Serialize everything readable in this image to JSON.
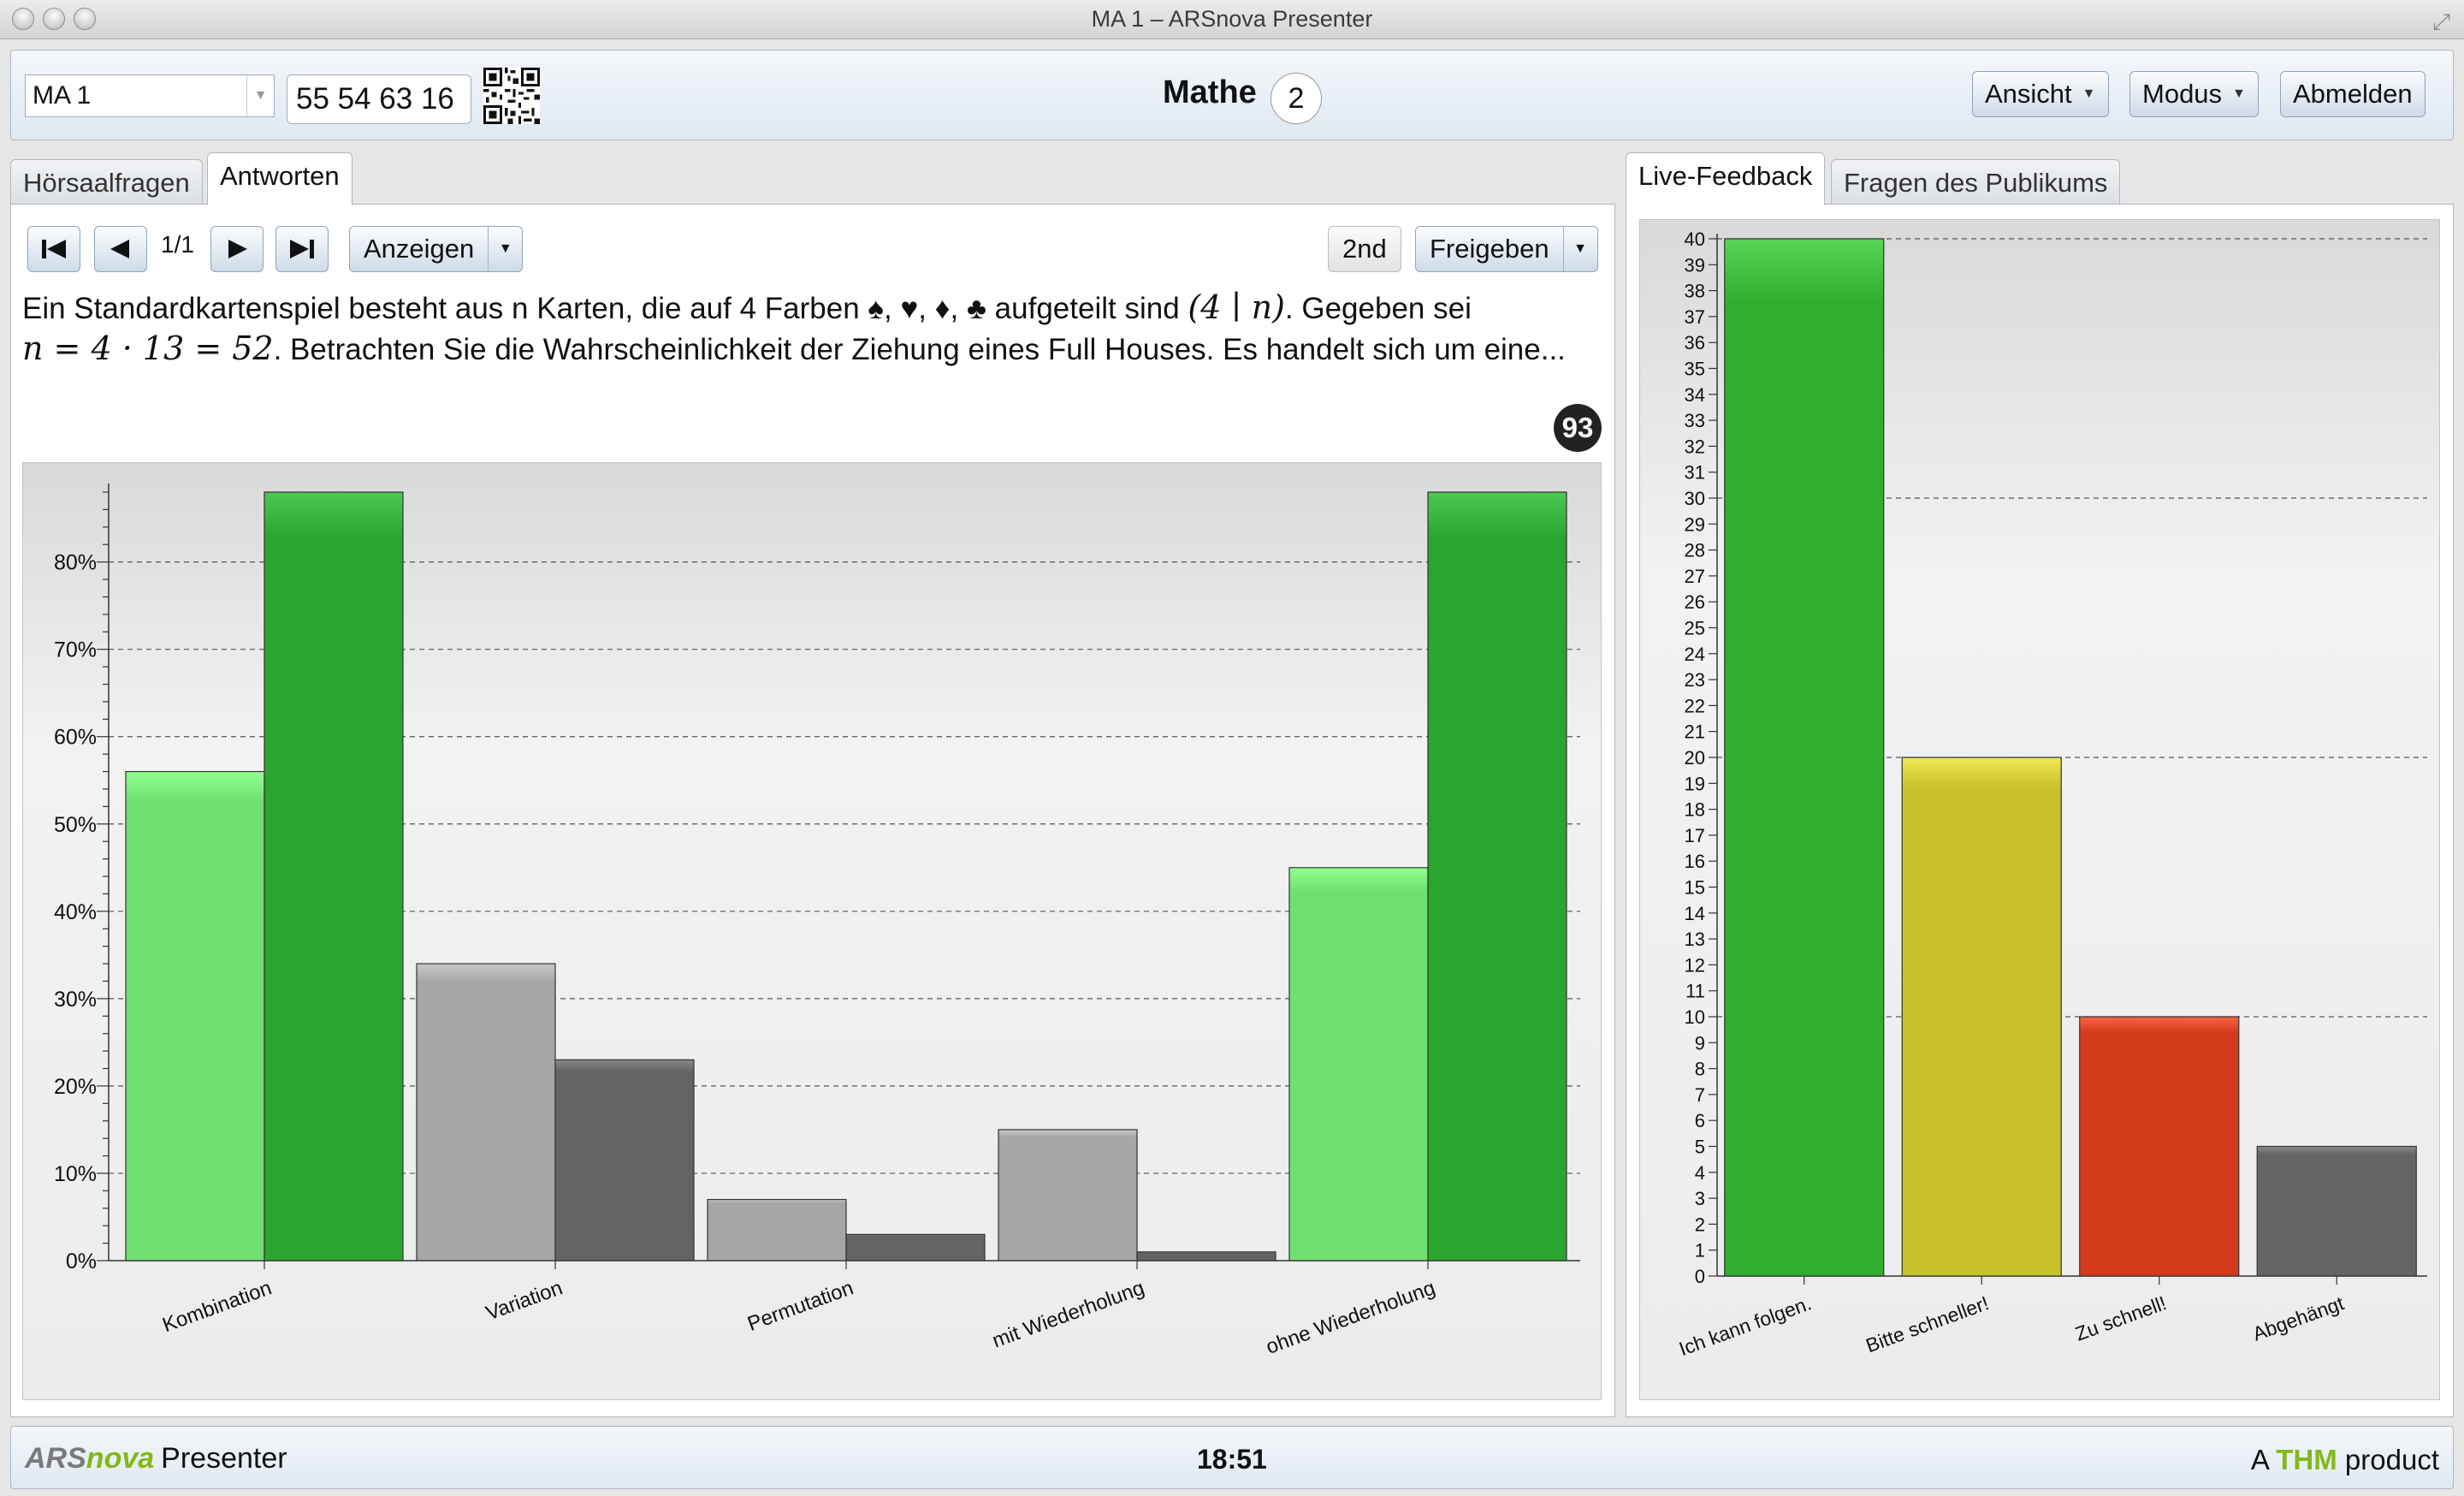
{
  "window": {
    "title": "MA 1 – ARSnova Presenter"
  },
  "toolbar": {
    "session_select": "MA 1",
    "session_key": "55 54 63 16",
    "session_name": "Mathe",
    "online_count": "2",
    "view_label": "Ansicht",
    "mode_label": "Modus",
    "logout_label": "Abmelden"
  },
  "left": {
    "tabs": [
      {
        "label": "Hörsaalfragen",
        "active": false
      },
      {
        "label": "Antworten",
        "active": true
      }
    ],
    "pager": "1/1",
    "show_label": "Anzeigen",
    "second_label": "2nd",
    "release_label": "Freigeben",
    "question_parts": {
      "p1": "Ein Standardkartenspiel besteht aus n Karten, die auf 4 Farben ♠, ♥, ♦, ♣ aufgeteilt sind ",
      "m1": "(4 ∣ n)",
      "p2": ". Gegeben sei",
      "m2": "n = 4 · 13 = 52",
      "p3": ". Betrachten Sie die Wahrscheinlichkeit der Ziehung eines Full Houses. Es handelt sich um eine..."
    },
    "answer_count": "93"
  },
  "right": {
    "tabs": [
      {
        "label": "Live-Feedback",
        "active": true
      },
      {
        "label": "Fragen des Publikums",
        "active": false
      }
    ]
  },
  "chart_data": [
    {
      "type": "bar",
      "categories": [
        "Kombination",
        "Variation",
        "Permutation",
        "mit Wiederholung",
        "ohne Wiederholung"
      ],
      "series": [
        {
          "values": [
            56,
            34,
            7,
            15,
            45
          ]
        },
        {
          "values": [
            88,
            23,
            3,
            1,
            88
          ]
        }
      ],
      "correct_categories": [
        "Kombination",
        "ohne Wiederholung"
      ],
      "ylim": [
        0,
        88
      ],
      "yticks": [
        0,
        10,
        20,
        30,
        40,
        50,
        60,
        70,
        80
      ],
      "ytick_format": "{v}%",
      "grid": true,
      "colors": {
        "correct_1": "#6fe06f",
        "correct_2": "#2aa52e",
        "other_1": "#a6a6a6",
        "other_2": "#646464"
      }
    },
    {
      "type": "bar",
      "categories": [
        "Ich kann folgen.",
        "Bitte schneller!",
        "Zu schnell!",
        "Abgehängt"
      ],
      "values": [
        40,
        20,
        10,
        5
      ],
      "ylim": [
        0,
        40
      ],
      "yticks_every": 1,
      "gridlines_at": [
        10,
        20,
        30,
        40
      ],
      "colors": [
        "#2fae30",
        "#c6c12c",
        "#d23c1c",
        "#656565"
      ]
    }
  ],
  "status": {
    "brand_a": "ARS",
    "brand_nova": "nova",
    "brand_rest": "Presenter",
    "time": "18:51",
    "product_a": "A",
    "product_thm": "THM",
    "product_rest": "product"
  }
}
